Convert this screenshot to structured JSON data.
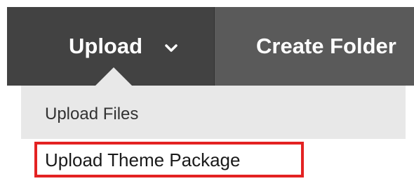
{
  "toolbar": {
    "upload_label": "Upload",
    "create_folder_label": "Create Folder"
  },
  "dropdown": {
    "items": [
      {
        "label": "Upload Files"
      },
      {
        "label": "Upload Theme Package"
      }
    ]
  },
  "icons": {
    "upload_chevron": "chevron-down-icon"
  },
  "colors": {
    "toolbar_bg": "#5a5a5a",
    "active_button_bg": "#424242",
    "dropdown_bg": "#e8e8e8",
    "highlight": "#e32222"
  }
}
